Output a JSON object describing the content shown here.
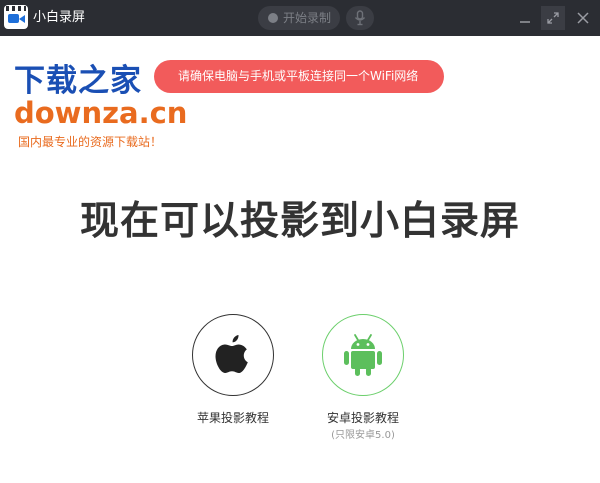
{
  "app": {
    "title": "小白录屏"
  },
  "toolbar": {
    "record_label": "开始录制"
  },
  "watermark": {
    "logo": "下载之家",
    "domain": "downza.cn",
    "slogan": "国内最专业的资源下载站！"
  },
  "toast": {
    "text": "请确保电脑与手机或平板连接同一个WiFi网络"
  },
  "main": {
    "heading": "现在可以投影到小白录屏",
    "options": [
      {
        "label": "苹果投影教程",
        "icon": "apple-icon"
      },
      {
        "label": "安卓投影教程",
        "note": "(只限安卓5.0)",
        "icon": "android-icon"
      }
    ]
  },
  "colors": {
    "titlebar": "#2b2d33",
    "toast": "#f25b5b",
    "android_green": "#6ccf6c",
    "logo_blue": "#1e6fd9"
  }
}
